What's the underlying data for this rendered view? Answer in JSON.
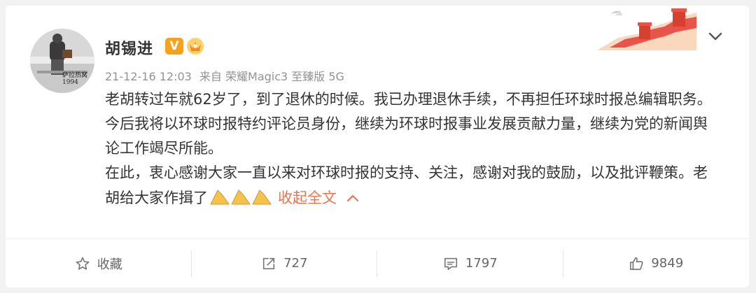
{
  "post": {
    "username": "胡锡进",
    "verified_badge": "V",
    "timestamp": "21-12-16 12:03",
    "source": "来自 荣耀Magic3 至臻版 5G",
    "paragraph1": "老胡转过年就62岁了，到了退休的时候。我已办理退休手续，不再担任环球时报总编辑职务。今后我将以环球时报特约评论员身份，继续为环球时报事业发展贡献力量，继续为党的新闻舆论工作竭尽所能。",
    "paragraph2": "在此，衷心感谢大家一直以来对环球时报的支持、关注，感谢对我的鼓励，以及批评鞭策。老胡给大家作揖了",
    "collapse_label": "收起全文",
    "avatar_caption": "萨拉热窝 1994"
  },
  "actions": {
    "favorite_label": "收藏",
    "repost_count": "727",
    "comment_count": "1797",
    "like_count": "9849"
  },
  "colors": {
    "link": "#eb7350",
    "meta": "#939393",
    "badge": "#f7a21b"
  }
}
